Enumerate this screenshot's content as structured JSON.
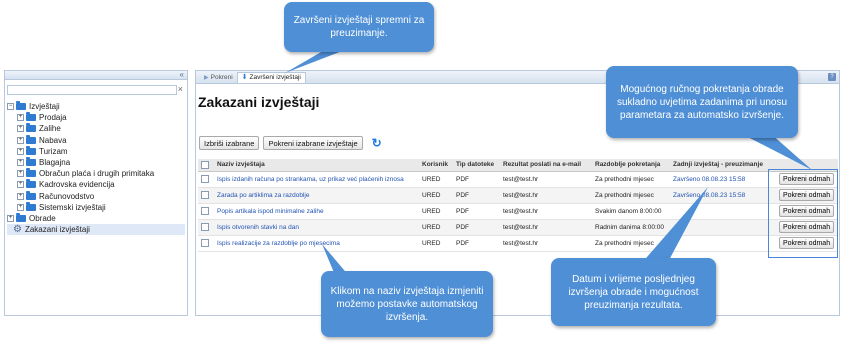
{
  "left": {
    "search": {
      "value": "",
      "placeholder": ""
    },
    "collapse_symbol": "«",
    "clear_symbol": "×",
    "tree": [
      {
        "label": "Izvještaji",
        "toggle": "−",
        "level": 0,
        "icon": "folder-icon"
      },
      {
        "label": "Prodaja",
        "toggle": "+",
        "level": 1,
        "icon": "folder-icon"
      },
      {
        "label": "Zalihe",
        "toggle": "+",
        "level": 1,
        "icon": "folder-icon"
      },
      {
        "label": "Nabava",
        "toggle": "+",
        "level": 1,
        "icon": "folder-icon"
      },
      {
        "label": "Turizam",
        "toggle": "+",
        "level": 1,
        "icon": "folder-icon"
      },
      {
        "label": "Blagajna",
        "toggle": "+",
        "level": 1,
        "icon": "folder-icon"
      },
      {
        "label": "Obračun plaća i drugih primitaka",
        "toggle": "+",
        "level": 1,
        "icon": "folder-icon"
      },
      {
        "label": "Kadrovska evidencija",
        "toggle": "+",
        "level": 1,
        "icon": "folder-icon"
      },
      {
        "label": "Računovodstvo",
        "toggle": "+",
        "level": 1,
        "icon": "folder-icon"
      },
      {
        "label": "Sistemski izvještaji",
        "toggle": "+",
        "level": 1,
        "icon": "folder-icon"
      },
      {
        "label": "Obrade",
        "toggle": "+",
        "level": 0,
        "icon": "folder-icon"
      },
      {
        "label": "Zakazani izvještaji",
        "toggle": "",
        "level": 0,
        "icon": "gear-icon",
        "selected": true
      }
    ]
  },
  "tabs": [
    {
      "label": "Pokreni",
      "active": false,
      "icon": "arrow-right-icon"
    },
    {
      "label": "Završeni izvještaji",
      "active": true,
      "icon": "download-arrow-icon"
    }
  ],
  "help_symbol": "?",
  "page_title": "Zakazani izvještaji",
  "toolbar": {
    "delete_label": "Izbriši izabrane",
    "run_selected_label": "Pokreni izabrane izvještaje",
    "refresh_icon": "refresh-icon"
  },
  "grid": {
    "headers": [
      "",
      "Naziv izvještaja",
      "Korisnik",
      "Tip datoteke",
      "Rezultat poslati na e-mail",
      "Razdoblje pokretanja",
      "Zadnji izvještaj - preuzimanje",
      ""
    ],
    "rows": [
      {
        "name": "Ispis izdanih računa po strankama, uz prikaz već plaćenih iznosa",
        "user": "URED",
        "type": "PDF",
        "email": "test@test.hr",
        "period": "Za prethodni mjesec",
        "last": "Završeno 08.08.23 15:58",
        "action": "Pokreni odmah"
      },
      {
        "name": "Zarada po artiklima za razdoblje",
        "user": "URED",
        "type": "PDF",
        "email": "test@test.hr",
        "period": "Za prethodni mjesec",
        "last": "Završeno 08.08.23 15:58",
        "action": "Pokreni odmah"
      },
      {
        "name": "Popis artikala ispod minimalne zalihe",
        "user": "URED",
        "type": "PDF",
        "email": "test@test.hr",
        "period": "Svakim danom 8:00:00",
        "last": "",
        "action": "Pokreni odmah"
      },
      {
        "name": "Ispis otvorenih stavki na dan",
        "user": "URED",
        "type": "PDF",
        "email": "test@test.hr",
        "period": "Radnim danima 8:00:00",
        "last": "",
        "action": "Pokreni odmah"
      },
      {
        "name": "Ispis realizacije za razdoblje po mjesecima",
        "user": "URED",
        "type": "PDF",
        "email": "test@test.hr",
        "period": "Za prethodni mjesec",
        "last": "",
        "action": "Pokreni odmah"
      }
    ]
  },
  "callouts": {
    "finished": "Završeni izvještaji spremni za preuzimanje.",
    "manual": "Mogućnog ručnog pokretanja obrade sukladno uvjetima zadanima pri unosu parametara za automatsko izvršenje.",
    "name_click": "Klikom na naziv izvještaja izmjeniti možemo postavke automatskog izvršenja.",
    "last_run": "Datum i vrijeme posljednjeg izvršenja obrade i mogućnost preuzimanja rezultata."
  },
  "colors": {
    "callout": "#4f8fd6",
    "link": "#2353b3",
    "folder": "#2e7bd1"
  }
}
